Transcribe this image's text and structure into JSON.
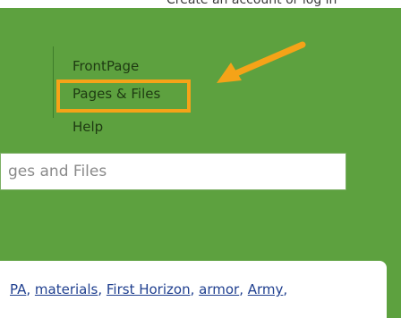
{
  "header": {
    "account_text": "Create an account or log in"
  },
  "nav": {
    "items": [
      {
        "label": "FrontPage"
      },
      {
        "label": "Pages & Files"
      },
      {
        "label": "Help"
      }
    ],
    "highlight_color": "#f5a318"
  },
  "search": {
    "placeholder": "ges and Files"
  },
  "tags": {
    "items": [
      "PA",
      "materials",
      "First Horizon",
      "armor",
      "Army"
    ],
    "separator": ", ",
    "trailing": ","
  },
  "colors": {
    "background": "#5da13f",
    "link": "#1f3f8f",
    "accent": "#f5a318"
  }
}
